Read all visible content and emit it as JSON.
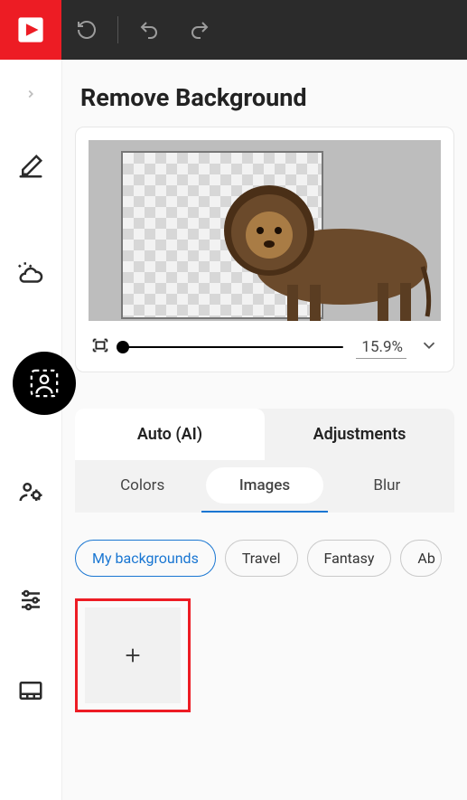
{
  "header": {
    "title": "Remove Background"
  },
  "zoom": {
    "value": "15.9%"
  },
  "tabs": {
    "main": [
      {
        "label": "Auto (AI)",
        "active": true
      },
      {
        "label": "Adjustments",
        "active": false
      }
    ],
    "sub": [
      {
        "label": "Colors",
        "active": false
      },
      {
        "label": "Images",
        "active": true
      },
      {
        "label": "Blur",
        "active": false
      }
    ]
  },
  "chips": [
    {
      "label": "My backgrounds",
      "active": true
    },
    {
      "label": "Travel",
      "active": false
    },
    {
      "label": "Fantasy",
      "active": false
    },
    {
      "label": "Ab",
      "active": false
    }
  ],
  "sidebar": {
    "items": [
      {
        "name": "eraser-icon"
      },
      {
        "name": "weather-icon"
      },
      {
        "name": "portrait-select-icon"
      },
      {
        "name": "people-settings-icon"
      },
      {
        "name": "sliders-icon"
      },
      {
        "name": "layout-icon"
      }
    ]
  }
}
